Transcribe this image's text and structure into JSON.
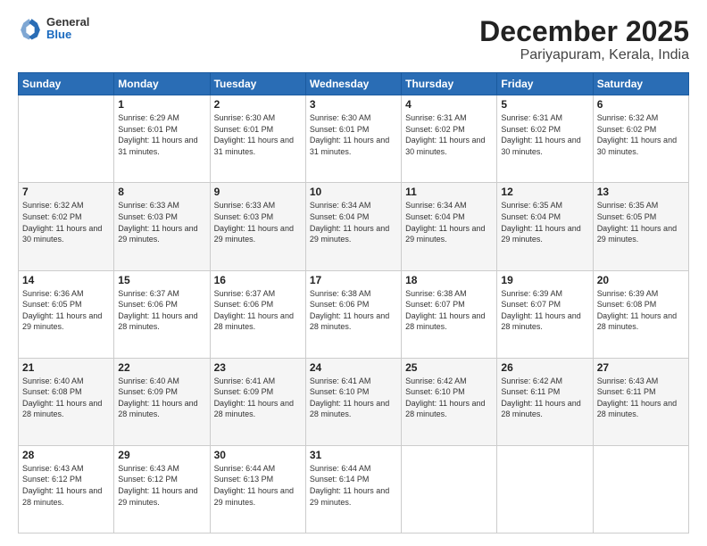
{
  "header": {
    "logo": {
      "general": "General",
      "blue": "Blue"
    },
    "title": "December 2025",
    "subtitle": "Pariyapuram, Kerala, India"
  },
  "calendar": {
    "weekdays": [
      "Sunday",
      "Monday",
      "Tuesday",
      "Wednesday",
      "Thursday",
      "Friday",
      "Saturday"
    ],
    "weeks": [
      [
        {
          "day": null
        },
        {
          "day": 1,
          "sunrise": "6:29 AM",
          "sunset": "6:01 PM",
          "daylight": "11 hours and 31 minutes."
        },
        {
          "day": 2,
          "sunrise": "6:30 AM",
          "sunset": "6:01 PM",
          "daylight": "11 hours and 31 minutes."
        },
        {
          "day": 3,
          "sunrise": "6:30 AM",
          "sunset": "6:01 PM",
          "daylight": "11 hours and 31 minutes."
        },
        {
          "day": 4,
          "sunrise": "6:31 AM",
          "sunset": "6:02 PM",
          "daylight": "11 hours and 30 minutes."
        },
        {
          "day": 5,
          "sunrise": "6:31 AM",
          "sunset": "6:02 PM",
          "daylight": "11 hours and 30 minutes."
        },
        {
          "day": 6,
          "sunrise": "6:32 AM",
          "sunset": "6:02 PM",
          "daylight": "11 hours and 30 minutes."
        }
      ],
      [
        {
          "day": 7,
          "sunrise": "6:32 AM",
          "sunset": "6:02 PM",
          "daylight": "11 hours and 30 minutes."
        },
        {
          "day": 8,
          "sunrise": "6:33 AM",
          "sunset": "6:03 PM",
          "daylight": "11 hours and 29 minutes."
        },
        {
          "day": 9,
          "sunrise": "6:33 AM",
          "sunset": "6:03 PM",
          "daylight": "11 hours and 29 minutes."
        },
        {
          "day": 10,
          "sunrise": "6:34 AM",
          "sunset": "6:04 PM",
          "daylight": "11 hours and 29 minutes."
        },
        {
          "day": 11,
          "sunrise": "6:34 AM",
          "sunset": "6:04 PM",
          "daylight": "11 hours and 29 minutes."
        },
        {
          "day": 12,
          "sunrise": "6:35 AM",
          "sunset": "6:04 PM",
          "daylight": "11 hours and 29 minutes."
        },
        {
          "day": 13,
          "sunrise": "6:35 AM",
          "sunset": "6:05 PM",
          "daylight": "11 hours and 29 minutes."
        }
      ],
      [
        {
          "day": 14,
          "sunrise": "6:36 AM",
          "sunset": "6:05 PM",
          "daylight": "11 hours and 29 minutes."
        },
        {
          "day": 15,
          "sunrise": "6:37 AM",
          "sunset": "6:06 PM",
          "daylight": "11 hours and 28 minutes."
        },
        {
          "day": 16,
          "sunrise": "6:37 AM",
          "sunset": "6:06 PM",
          "daylight": "11 hours and 28 minutes."
        },
        {
          "day": 17,
          "sunrise": "6:38 AM",
          "sunset": "6:06 PM",
          "daylight": "11 hours and 28 minutes."
        },
        {
          "day": 18,
          "sunrise": "6:38 AM",
          "sunset": "6:07 PM",
          "daylight": "11 hours and 28 minutes."
        },
        {
          "day": 19,
          "sunrise": "6:39 AM",
          "sunset": "6:07 PM",
          "daylight": "11 hours and 28 minutes."
        },
        {
          "day": 20,
          "sunrise": "6:39 AM",
          "sunset": "6:08 PM",
          "daylight": "11 hours and 28 minutes."
        }
      ],
      [
        {
          "day": 21,
          "sunrise": "6:40 AM",
          "sunset": "6:08 PM",
          "daylight": "11 hours and 28 minutes."
        },
        {
          "day": 22,
          "sunrise": "6:40 AM",
          "sunset": "6:09 PM",
          "daylight": "11 hours and 28 minutes."
        },
        {
          "day": 23,
          "sunrise": "6:41 AM",
          "sunset": "6:09 PM",
          "daylight": "11 hours and 28 minutes."
        },
        {
          "day": 24,
          "sunrise": "6:41 AM",
          "sunset": "6:10 PM",
          "daylight": "11 hours and 28 minutes."
        },
        {
          "day": 25,
          "sunrise": "6:42 AM",
          "sunset": "6:10 PM",
          "daylight": "11 hours and 28 minutes."
        },
        {
          "day": 26,
          "sunrise": "6:42 AM",
          "sunset": "6:11 PM",
          "daylight": "11 hours and 28 minutes."
        },
        {
          "day": 27,
          "sunrise": "6:43 AM",
          "sunset": "6:11 PM",
          "daylight": "11 hours and 28 minutes."
        }
      ],
      [
        {
          "day": 28,
          "sunrise": "6:43 AM",
          "sunset": "6:12 PM",
          "daylight": "11 hours and 28 minutes."
        },
        {
          "day": 29,
          "sunrise": "6:43 AM",
          "sunset": "6:12 PM",
          "daylight": "11 hours and 29 minutes."
        },
        {
          "day": 30,
          "sunrise": "6:44 AM",
          "sunset": "6:13 PM",
          "daylight": "11 hours and 29 minutes."
        },
        {
          "day": 31,
          "sunrise": "6:44 AM",
          "sunset": "6:14 PM",
          "daylight": "11 hours and 29 minutes."
        },
        {
          "day": null
        },
        {
          "day": null
        },
        {
          "day": null
        }
      ]
    ]
  }
}
